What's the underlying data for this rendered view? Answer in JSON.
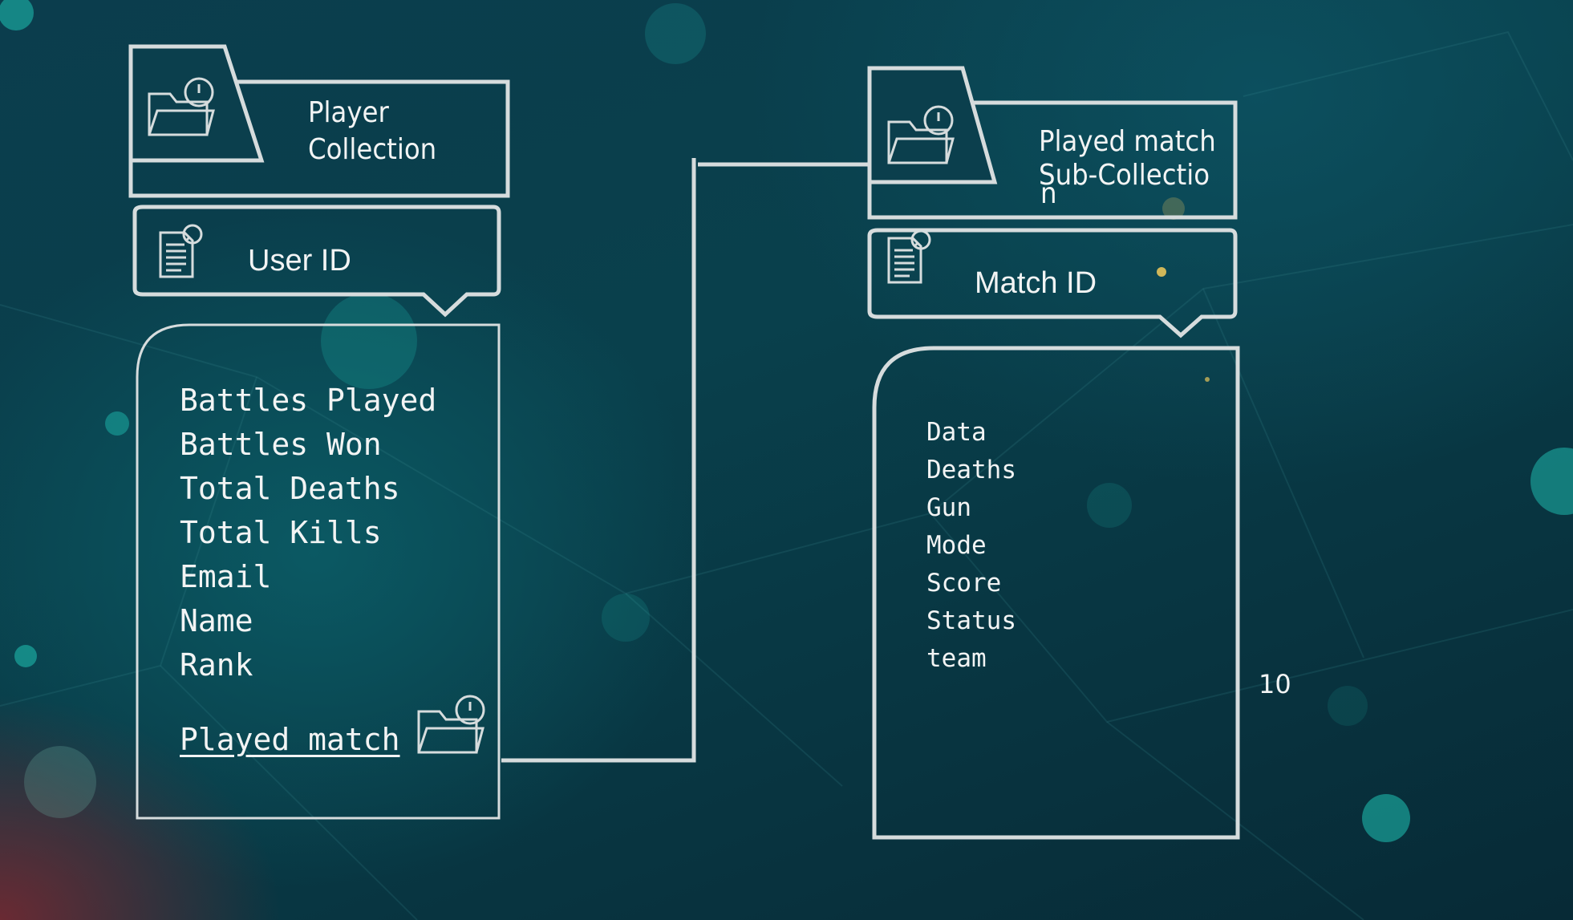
{
  "player_collection": {
    "title_line1": "Player",
    "title_line2": "Collection",
    "document_label": "User ID",
    "fields": [
      "Battles Played",
      "Battles Won",
      "Total Deaths",
      "Total Kills",
      "Email",
      "Name",
      "Rank"
    ],
    "subcollection_link": "Played match"
  },
  "played_match_collection": {
    "title_line1": "Played match",
    "title_line2": "Sub-Collectio",
    "title_line3": "n",
    "document_label": "Match ID",
    "fields": [
      "Data",
      "Deaths",
      "Gun",
      "Mode",
      "Score",
      "Status",
      "team"
    ]
  },
  "page_number": "10",
  "colors": {
    "line": "#d6dcdd",
    "text": "#f2f4f4",
    "accent_glow": "#1fc3b5"
  }
}
